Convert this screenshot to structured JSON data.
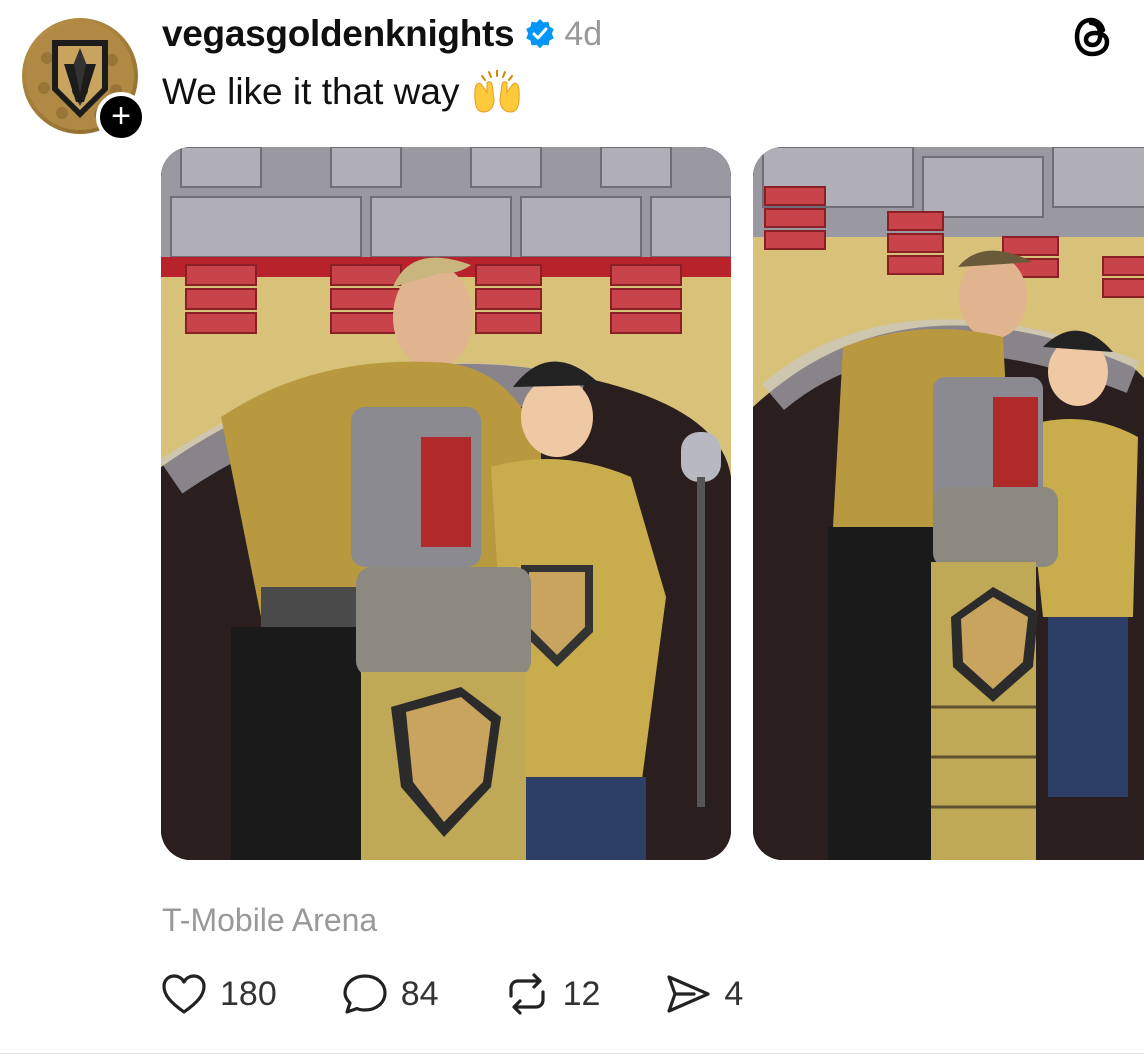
{
  "post": {
    "username": "vegasgoldenknights",
    "timestamp": "4d",
    "caption": "We like it that way",
    "caption_emoji": "raising-hands-emoji",
    "location": "T-Mobile Arena",
    "follow_label": "+",
    "verified": true
  },
  "actions": {
    "likes": "180",
    "replies": "84",
    "reposts": "12",
    "shares": "4"
  },
  "media": {
    "count": 2
  },
  "colors": {
    "brand_gold": "#B4975A",
    "verified_blue": "#0095F6",
    "muted_text": "#999999"
  },
  "icons": [
    "heart-icon",
    "comment-icon",
    "repost-icon",
    "share-icon",
    "threads-logo-icon",
    "verified-badge-icon"
  ]
}
